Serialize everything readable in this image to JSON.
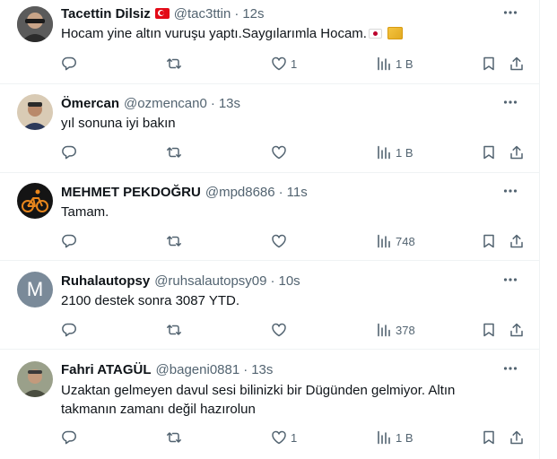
{
  "tweets": [
    {
      "name": "Tacettin Dilsiz",
      "has_flag": true,
      "handle": "@tac3ttin",
      "dot": "·",
      "time": "12s",
      "text": "Hocam yine altın vuruşu yaptı.Saygılarımla Hocam.",
      "emojis": [
        "japan-flag",
        "gold-bar"
      ],
      "like_count": "1",
      "views": "1 B",
      "avatar_color": "#3a3a3a"
    },
    {
      "name": "Ömercan",
      "handle": "@ozmencan0",
      "dot": "·",
      "time": "13s",
      "text": "yıl sonuna iyi bakın",
      "like_count": "",
      "views": "1 B",
      "avatar_color": "#c9b79c"
    },
    {
      "name": "MEHMET PEKDOĞRU",
      "handle": "@mpd8686",
      "dot": "·",
      "time": "11s",
      "text": "Tamam.",
      "like_count": "",
      "views": "748",
      "avatar_color": "#1a1a1a"
    },
    {
      "name": "Ruhalautopsy",
      "handle": "@ruhsalautopsy09",
      "dot": "·",
      "time": "10s",
      "text": "2100 destek sonra 3087 YTD.",
      "like_count": "",
      "views": "378",
      "avatar_letter": "M",
      "avatar_color": "#7a8a99"
    },
    {
      "name": "Fahri ATAGÜL",
      "handle": "@bageni0881",
      "dot": "·",
      "time": "13s",
      "text": "Uzaktan gelmeyen davul sesi bilinizki bir Dügünden gelmiyor. Altın takmanın zamanı değil hazırolun",
      "like_count": "1",
      "views": "1 B",
      "avatar_color": "#8a8c7a"
    }
  ],
  "colors": {
    "text_primary": "#0f1419",
    "text_secondary": "#536471",
    "border": "#eff3f4"
  }
}
